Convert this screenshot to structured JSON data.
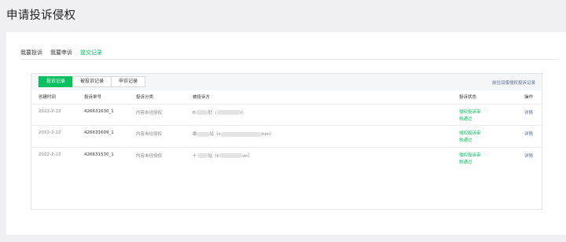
{
  "page": {
    "title": "申请投诉侵权"
  },
  "tabs": [
    {
      "label": "我要投诉",
      "active": false
    },
    {
      "label": "我要申诉",
      "active": false
    },
    {
      "label": "提交记录",
      "active": true
    }
  ],
  "subtabs": [
    {
      "label": "投诉记录",
      "active": true
    },
    {
      "label": "被投诉记录",
      "active": false
    },
    {
      "label": "申诉记录",
      "active": false
    }
  ],
  "history_link": "前往旧版侵权投诉记录",
  "table": {
    "headers": [
      "创建时间",
      "投诉单号",
      "投诉分类",
      "被投诉方",
      "投诉状态",
      "操作"
    ],
    "rows": [
      {
        "date": "2022-2-22",
        "id": "426631630_1",
        "category": "内容未经授权",
        "party_a": "B",
        "party_b": "肘（",
        "party_c": "i）",
        "status_1": "侵权投诉审",
        "status_2": "核通过",
        "action": "详情"
      },
      {
        "date": "2022-2-22",
        "id": "426631609_1",
        "category": "内容未经授权",
        "party_a": "敢",
        "party_b": "站（x",
        "party_c": "han）",
        "status_1": "侵权投诉审",
        "status_2": "核通过",
        "action": "详情"
      },
      {
        "date": "2022-2-22",
        "id": "426631530_1",
        "category": "内容未经授权",
        "party_a": "十",
        "party_b": "站（k",
        "party_c": "an）",
        "status_1": "侵权投诉审",
        "status_2": "核通过",
        "action": "详情"
      }
    ]
  },
  "colors": {
    "accent": "#07c160",
    "link": "#576b95",
    "background": "#f0f0f2"
  }
}
